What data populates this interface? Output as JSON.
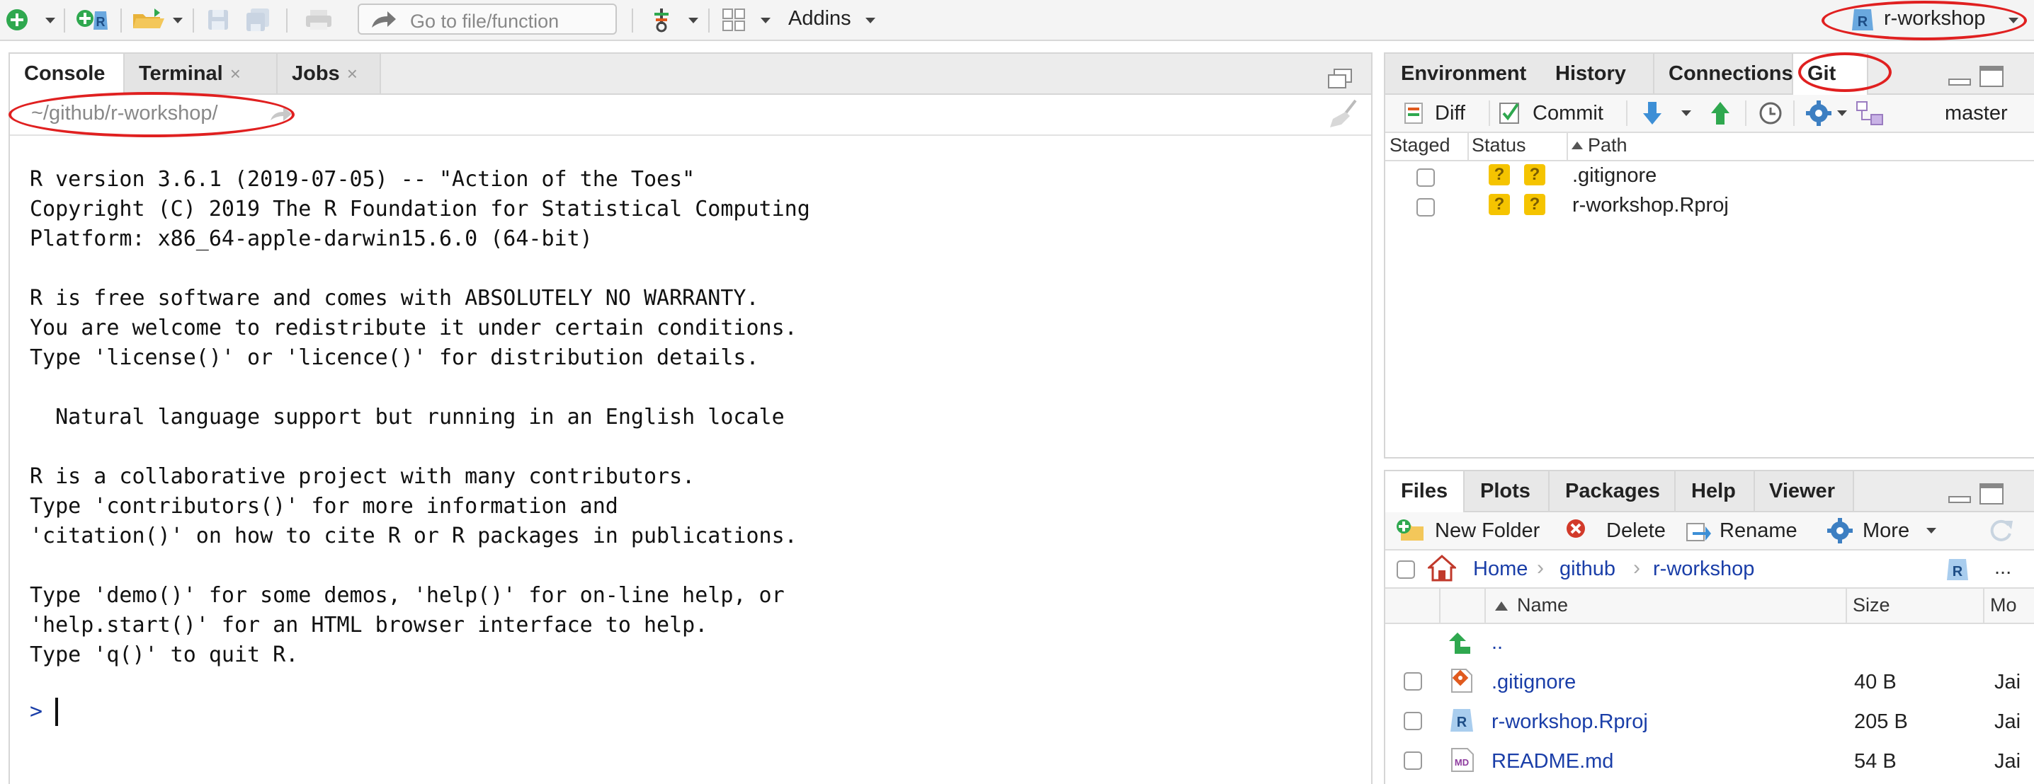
{
  "toolbar": {
    "goto_placeholder": "Go to file/function",
    "addins_label": "Addins",
    "project_label": "r-workshop"
  },
  "left_pane": {
    "tabs": [
      {
        "label": "Console"
      },
      {
        "label": "Terminal",
        "close": "×"
      },
      {
        "label": "Jobs",
        "close": "×"
      }
    ],
    "working_dir": "~/github/r-workshop/",
    "console_lines": [
      "R version 3.6.1 (2019-07-05) -- \"Action of the Toes\"",
      "Copyright (C) 2019 The R Foundation for Statistical Computing",
      "Platform: x86_64-apple-darwin15.6.0 (64-bit)",
      "R is free software and comes with ABSOLUTELY NO WARRANTY.",
      "You are welcome to redistribute it under certain conditions.",
      "Type 'license()' or 'licence()' for distribution details.",
      "  Natural language support but running in an English locale",
      "R is a collaborative project with many contributors.",
      "Type 'contributors()' for more information and",
      "'citation()' on how to cite R or R packages in publications.",
      "Type 'demo()' for some demos, 'help()' for on-line help, or",
      "'help.start()' for an HTML browser interface to help.",
      "Type 'q()' to quit R."
    ],
    "prompt": ">"
  },
  "git_pane": {
    "tabs": [
      {
        "label": "Environment"
      },
      {
        "label": "History"
      },
      {
        "label": "Connections"
      },
      {
        "label": "Git"
      }
    ],
    "diff_label": "Diff",
    "commit_label": "Commit",
    "branch": "master",
    "headers": {
      "staged": "Staged",
      "status": "Status",
      "path": "Path"
    },
    "rows": [
      {
        "status": "?",
        "path": ".gitignore"
      },
      {
        "status": "?",
        "path": "r-workshop.Rproj"
      }
    ]
  },
  "files_pane": {
    "tabs": [
      {
        "label": "Files"
      },
      {
        "label": "Plots"
      },
      {
        "label": "Packages"
      },
      {
        "label": "Help"
      },
      {
        "label": "Viewer"
      }
    ],
    "new_folder_label": "New Folder",
    "delete_label": "Delete",
    "rename_label": "Rename",
    "more_label": "More",
    "breadcrumb": {
      "home": "Home",
      "sep": "›",
      "p1": "github",
      "p2": "r-workshop",
      "overflow": "..."
    },
    "headers": {
      "name": "Name",
      "size": "Size",
      "modified": "Mo"
    },
    "up_label": "..",
    "files": [
      {
        "name": ".gitignore",
        "size": "40 B",
        "modified": "Jai"
      },
      {
        "name": "r-workshop.Rproj",
        "size": "205 B",
        "modified": "Jai"
      },
      {
        "name": "README.md",
        "size": "54 B",
        "modified": "Jai"
      }
    ]
  },
  "colors": {
    "highlight": "#e02020",
    "link": "#1a3ea8",
    "status_badge": "#f5c400"
  }
}
